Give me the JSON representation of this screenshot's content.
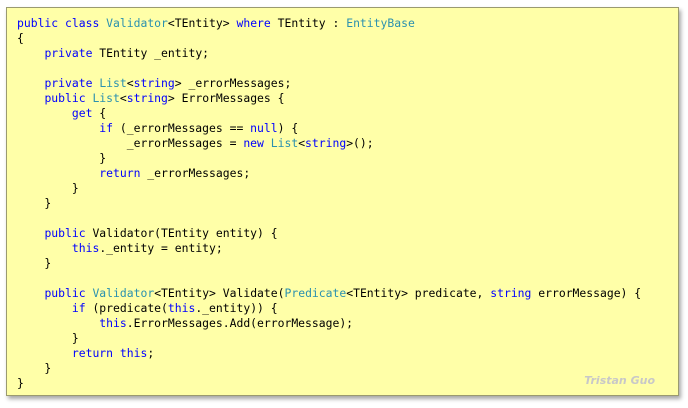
{
  "colors": {
    "background": "#ffffa8",
    "keyword": "#0000ff",
    "type": "#2b91af",
    "text": "#000000",
    "watermark": "#c8c8c8"
  },
  "code_lines": [
    [
      [
        "k",
        "public"
      ],
      [
        "p",
        " "
      ],
      [
        "k",
        "class"
      ],
      [
        "p",
        " "
      ],
      [
        "t",
        "Validator"
      ],
      [
        "p",
        "<TEntity> "
      ],
      [
        "k",
        "where"
      ],
      [
        "p",
        " TEntity : "
      ],
      [
        "t",
        "EntityBase"
      ]
    ],
    [
      [
        "p",
        "{"
      ]
    ],
    [
      [
        "p",
        "    "
      ],
      [
        "k",
        "private"
      ],
      [
        "p",
        " TEntity _entity;"
      ]
    ],
    [
      [
        "p",
        ""
      ]
    ],
    [
      [
        "p",
        "    "
      ],
      [
        "k",
        "private"
      ],
      [
        "p",
        " "
      ],
      [
        "t",
        "List"
      ],
      [
        "p",
        "<"
      ],
      [
        "k",
        "string"
      ],
      [
        "p",
        "> _errorMessages;"
      ]
    ],
    [
      [
        "p",
        "    "
      ],
      [
        "k",
        "public"
      ],
      [
        "p",
        " "
      ],
      [
        "t",
        "List"
      ],
      [
        "p",
        "<"
      ],
      [
        "k",
        "string"
      ],
      [
        "p",
        "> ErrorMessages {"
      ]
    ],
    [
      [
        "p",
        "        "
      ],
      [
        "k",
        "get"
      ],
      [
        "p",
        " {"
      ]
    ],
    [
      [
        "p",
        "            "
      ],
      [
        "k",
        "if"
      ],
      [
        "p",
        " (_errorMessages == "
      ],
      [
        "k",
        "null"
      ],
      [
        "p",
        ") {"
      ]
    ],
    [
      [
        "p",
        "                _errorMessages = "
      ],
      [
        "k",
        "new"
      ],
      [
        "p",
        " "
      ],
      [
        "t",
        "List"
      ],
      [
        "p",
        "<"
      ],
      [
        "k",
        "string"
      ],
      [
        "p",
        ">();"
      ]
    ],
    [
      [
        "p",
        "            }"
      ]
    ],
    [
      [
        "p",
        "            "
      ],
      [
        "k",
        "return"
      ],
      [
        "p",
        " _errorMessages;"
      ]
    ],
    [
      [
        "p",
        "        }"
      ]
    ],
    [
      [
        "p",
        "    }"
      ]
    ],
    [
      [
        "p",
        ""
      ]
    ],
    [
      [
        "p",
        "    "
      ],
      [
        "k",
        "public"
      ],
      [
        "p",
        " Validator(TEntity entity) {"
      ]
    ],
    [
      [
        "p",
        "        "
      ],
      [
        "k",
        "this"
      ],
      [
        "p",
        "._entity = entity;"
      ]
    ],
    [
      [
        "p",
        "    }"
      ]
    ],
    [
      [
        "p",
        ""
      ]
    ],
    [
      [
        "p",
        "    "
      ],
      [
        "k",
        "public"
      ],
      [
        "p",
        " "
      ],
      [
        "t",
        "Validator"
      ],
      [
        "p",
        "<TEntity> Validate("
      ],
      [
        "t",
        "Predicate"
      ],
      [
        "p",
        "<TEntity> predicate, "
      ],
      [
        "k",
        "string"
      ],
      [
        "p",
        " errorMessage) {"
      ]
    ],
    [
      [
        "p",
        "        "
      ],
      [
        "k",
        "if"
      ],
      [
        "p",
        " (predicate("
      ],
      [
        "k",
        "this"
      ],
      [
        "p",
        "._entity)) {"
      ]
    ],
    [
      [
        "p",
        "            "
      ],
      [
        "k",
        "this"
      ],
      [
        "p",
        ".ErrorMessages.Add(errorMessage);"
      ]
    ],
    [
      [
        "p",
        "        }"
      ]
    ],
    [
      [
        "p",
        "        "
      ],
      [
        "k",
        "return"
      ],
      [
        "p",
        " "
      ],
      [
        "k",
        "this"
      ],
      [
        "p",
        ";"
      ]
    ],
    [
      [
        "p",
        "    }"
      ]
    ],
    [
      [
        "p",
        "}"
      ]
    ]
  ],
  "watermark": "Tristan Guo"
}
